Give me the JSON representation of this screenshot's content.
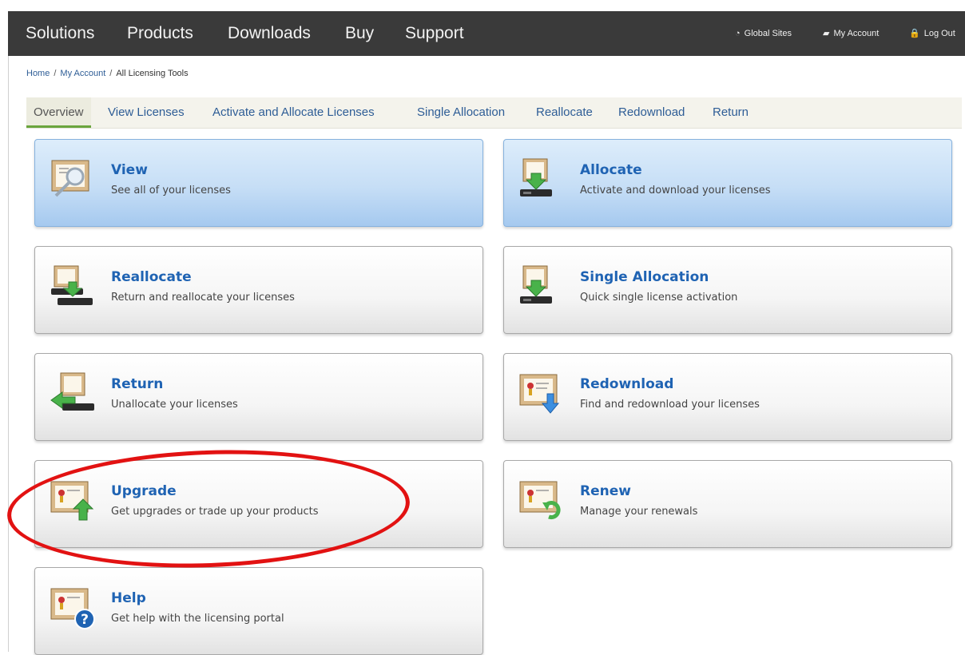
{
  "topnav": {
    "items": [
      "Solutions",
      "Products",
      "Downloads",
      "Buy",
      "Support"
    ],
    "global_sites": "Global Sites",
    "my_account": "My Account",
    "log_out": "Log Out"
  },
  "breadcrumb": {
    "home": "Home",
    "my_account": "My Account",
    "current": "All Licensing Tools",
    "separator": "/"
  },
  "subnav": {
    "tabs": [
      "Overview",
      "View Licenses",
      "Activate and Allocate Licenses",
      "Single Allocation",
      "Reallocate",
      "Redownload",
      "Return"
    ],
    "active": "Overview"
  },
  "cards": [
    {
      "title": "View",
      "desc": "See all of your licenses",
      "icon": "magnifier-certificate-icon",
      "highlighted": true
    },
    {
      "title": "Allocate",
      "desc": "Activate and download your licenses",
      "icon": "certificate-download-icon",
      "highlighted": true
    },
    {
      "title": "Reallocate",
      "desc": "Return and reallocate your licenses",
      "icon": "certificate-reallocate-icon",
      "highlighted": false
    },
    {
      "title": "Single Allocation",
      "desc": "Quick single license activation",
      "icon": "certificate-download-icon",
      "highlighted": false
    },
    {
      "title": "Return",
      "desc": "Unallocate your licenses",
      "icon": "certificate-return-icon",
      "highlighted": false
    },
    {
      "title": "Redownload",
      "desc": "Find and redownload your licenses",
      "icon": "certificate-redownload-icon",
      "highlighted": false
    },
    {
      "title": "Upgrade",
      "desc": "Get upgrades or trade up your products",
      "icon": "certificate-upgrade-icon",
      "highlighted": false
    },
    {
      "title": "Renew",
      "desc": "Manage your renewals",
      "icon": "certificate-renew-icon",
      "highlighted": false
    },
    {
      "title": "Help",
      "desc": "Get help with the licensing portal",
      "icon": "certificate-help-icon",
      "highlighted": false
    }
  ],
  "colors": {
    "nav_bg": "#3a3a3a",
    "link_blue": "#1f63b3",
    "active_tab_underline": "#6aa53d",
    "highlight_ring": "#e21212"
  }
}
